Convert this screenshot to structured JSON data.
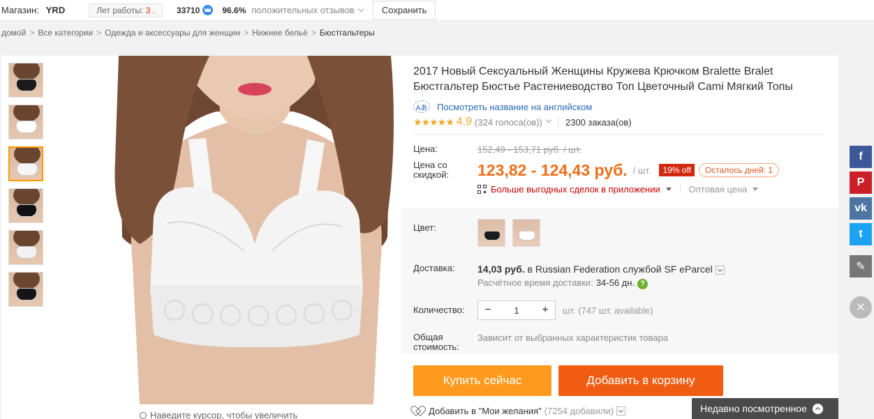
{
  "store": {
    "label": "Магазин:",
    "name": "YRD",
    "years_label": "Лет работы: ",
    "years_value": "3 .",
    "score": "33710",
    "positive_pct": "96.6%",
    "feedback_label": "положительных отзывов",
    "save_label": "Сохранить"
  },
  "breadcrumb": [
    "домой",
    "Все категории",
    "Одежда и аксессуары для женщин",
    "Нижнее бельё",
    "Бюстгальтеры"
  ],
  "breadcrumb_sep": ">",
  "gallery": {
    "thumbs": [
      {
        "color": "#1a1a1a"
      },
      {
        "color": "#ffffff"
      },
      {
        "color": "#f5f5f5",
        "active": true
      },
      {
        "color": "#111111"
      },
      {
        "color": "#f2f2f2"
      },
      {
        "color": "#151515"
      }
    ],
    "zoom_hint": "Наведите курсор, чтобы увеличить"
  },
  "product": {
    "title": "2017 Новый Сексуальный Женщины Кружева Крючком Bralette Bralet Бюстгальтер Бюстье Растениеводство Топ Цветочный Cami Мягкий Топы",
    "translate_link": "Посмотреть название на английском",
    "translate_icon": "Aあ",
    "stars": "★★★★★",
    "rating": "4.9",
    "votes": "(324 голоса(ов))",
    "orders": "2300 заказа(ов)"
  },
  "price": {
    "label": "Цена:",
    "old": "152,49 - 153,71 руб. / шт.",
    "discount_label": "Цена со скидкой:",
    "new": "123,82 - 124,43 руб.",
    "unit": "/ шт.",
    "off_badge": "19% off",
    "days_left": "Осталось дней: 1",
    "app_deals": "Больше выгодных сделок в приложении",
    "wholesale": "Оптовая цена"
  },
  "options": {
    "color_label": "Цвет:",
    "colors": [
      "#1a1a1a",
      "#ffffff"
    ],
    "shipping_label": "Доставка:",
    "shipping_price": "14,03 руб.",
    "shipping_in": " в ",
    "shipping_service": "Russian Federation службой SF eParcel",
    "delivery_est_label": "Расчётное время доставки:",
    "delivery_days": "34-56 дн.",
    "help": "?",
    "qty_label": "Количество:",
    "qty_minus": "−",
    "qty_value": "1",
    "qty_plus": "+",
    "qty_avail": "шт. (747 шт. available)",
    "total_label": "Общая стоимость:",
    "total_value": "Зависит от выбранных характеристик товара"
  },
  "actions": {
    "buy_now": "Купить сейчас",
    "add_to_cart": "Добавить в корзину",
    "wishlist": "Добавить в \"Мои желания\"",
    "wishlist_count": "(7254 добавили)"
  },
  "recently_viewed": "Недавно посмотренное",
  "social": [
    {
      "name": "facebook",
      "glyph": "f",
      "color": "#3b5998"
    },
    {
      "name": "pinterest",
      "glyph": "P",
      "color": "#cb2027"
    },
    {
      "name": "vk",
      "glyph": "vk",
      "color": "#4c75a3"
    },
    {
      "name": "twitter",
      "glyph": "t",
      "color": "#1da1f2"
    },
    {
      "name": "edit",
      "glyph": "✎",
      "color": "#777777"
    }
  ],
  "close_glyph": "✕"
}
